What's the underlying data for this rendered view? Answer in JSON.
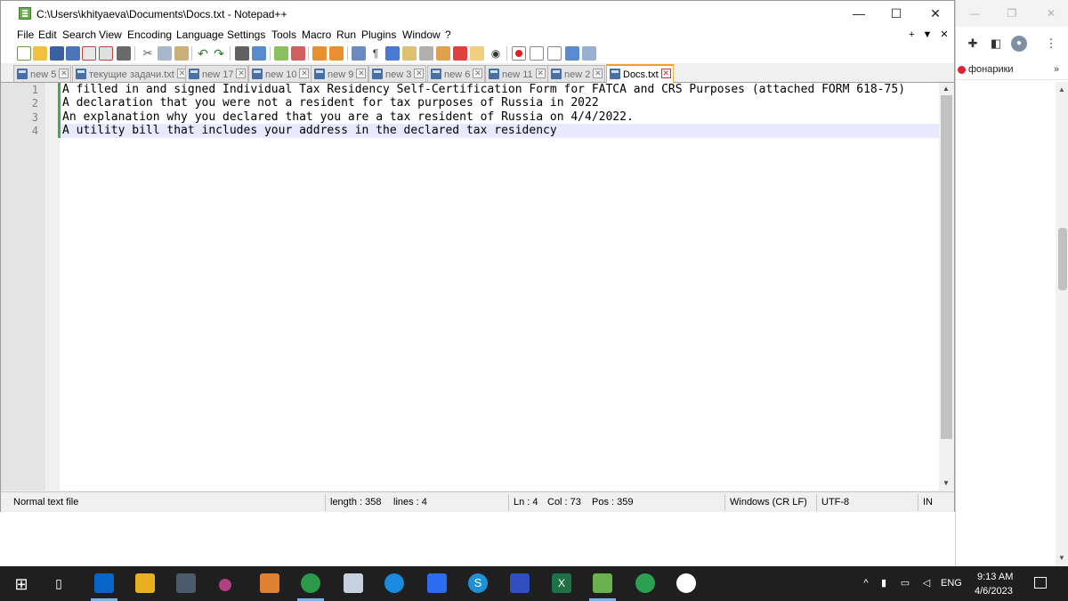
{
  "window": {
    "title": "C:\\Users\\khityaeva\\Documents\\Docs.txt - Notepad++",
    "minimize": "—",
    "maximize": "☐",
    "close": "✕"
  },
  "menu": {
    "items": [
      "File",
      "Edit",
      "Search",
      "View",
      "Encoding",
      "Language",
      "Settings",
      "Tools",
      "Macro",
      "Run",
      "Plugins",
      "Window",
      "?"
    ],
    "right_controls": "+ ▼ ✕"
  },
  "tabs": [
    {
      "label": "new 5",
      "active": false
    },
    {
      "label": "текущие задачи.txt",
      "active": false
    },
    {
      "label": "new 17",
      "active": false
    },
    {
      "label": "new 10",
      "active": false
    },
    {
      "label": "new 9",
      "active": false
    },
    {
      "label": "new 3",
      "active": false
    },
    {
      "label": "new 6",
      "active": false
    },
    {
      "label": "new 11",
      "active": false
    },
    {
      "label": "new 2",
      "active": false
    },
    {
      "label": "Docs.txt",
      "active": true
    }
  ],
  "editor": {
    "lines": [
      {
        "num": "1",
        "text": "A filled in and signed Individual Tax Residency Self-Certification Form for FATCA and CRS Purposes (attached FORM 618-75)"
      },
      {
        "num": "2",
        "text": "A declaration that you were not a resident for tax purposes of Russia in 2022"
      },
      {
        "num": "3",
        "text": "An explanation why you declared that you are a tax resident of Russia on 4/4/2022."
      },
      {
        "num": "4",
        "text": "A utility bill that includes your address in the declared tax residency"
      }
    ]
  },
  "status": {
    "file_type": "Normal text file",
    "length": "length : 358",
    "lines": "lines : 4",
    "ln": "Ln : 4",
    "col": "Col : 73",
    "pos": "Pos : 359",
    "eol": "Windows (CR LF)",
    "encoding": "UTF-8",
    "mode": "IN"
  },
  "browser": {
    "bookmark": "фонарики",
    "more": "»"
  },
  "taskbar": {
    "lang": "ENG",
    "time": "9:13 AM",
    "date": "4/6/2023"
  },
  "colors": {
    "active_tab_border": "#f0a030",
    "current_line": "#e8e8ff",
    "modified_bar": "#44aa44",
    "taskbar": "#1f1f1f"
  }
}
